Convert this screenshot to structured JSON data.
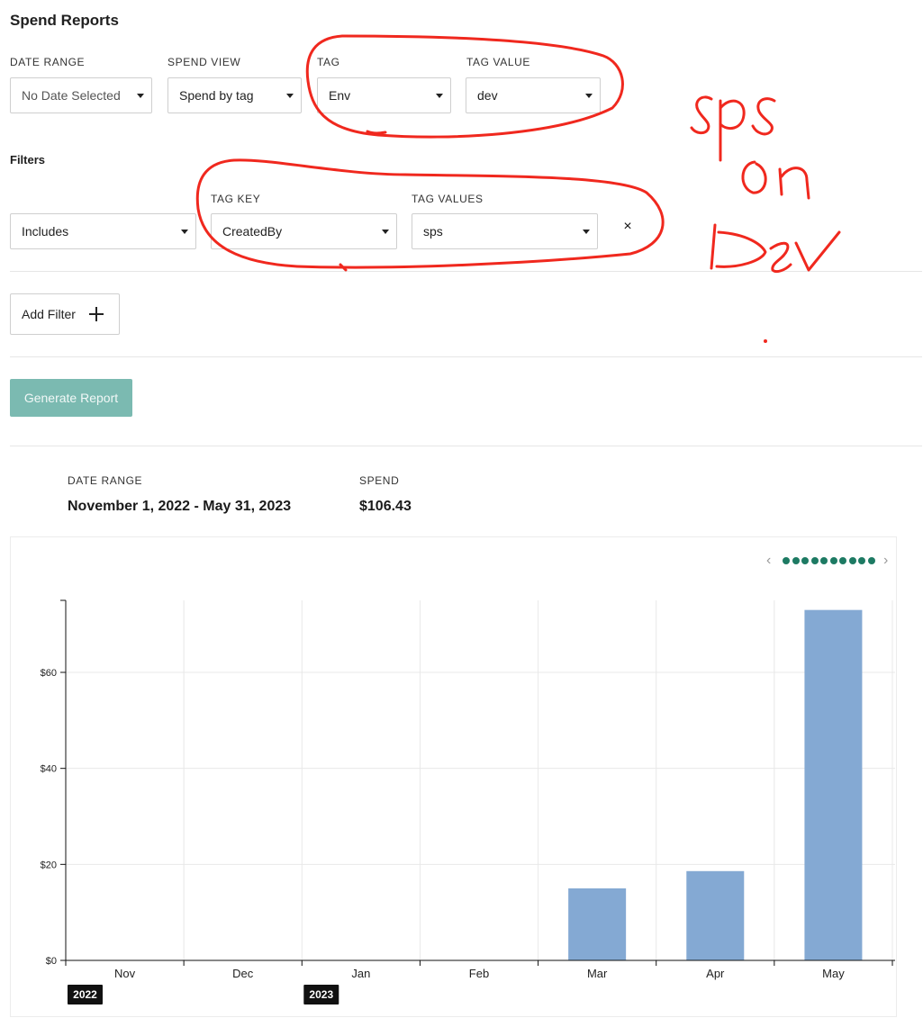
{
  "page": {
    "title": "Spend Reports"
  },
  "controls": {
    "date_range": {
      "label": "DATE RANGE",
      "value": "No Date Selected"
    },
    "spend_view": {
      "label": "SPEND VIEW",
      "value": "Spend by tag"
    },
    "tag": {
      "label": "TAG",
      "value": "Env"
    },
    "tag_value": {
      "label": "TAG VALUE",
      "value": "dev"
    }
  },
  "filters": {
    "title": "Filters",
    "operator": "Includes",
    "tag_key": {
      "label": "TAG KEY",
      "value": "CreatedBy"
    },
    "tag_values": {
      "label": "TAG VALUES",
      "value": "sps"
    },
    "remove_glyph": "×",
    "add_label": "Add Filter"
  },
  "actions": {
    "generate_label": "Generate Report"
  },
  "summary": {
    "date_range_label": "DATE RANGE",
    "date_range_value": "November 1, 2022 - May 31, 2023",
    "spend_label": "SPEND",
    "spend_value": "$106.43"
  },
  "pager": {
    "dots": 10,
    "active_index": 9
  },
  "colors": {
    "accent": "#1d7a63",
    "button_disabled": "#7bbab1",
    "bar": "#84a9d3",
    "annotation": "#f0281e"
  },
  "annotation": {
    "text": "sps on Dev"
  },
  "chart_data": {
    "type": "bar",
    "categories": [
      "Nov",
      "Dec",
      "Jan",
      "Feb",
      "Mar",
      "Apr",
      "May"
    ],
    "year_labels": [
      {
        "category": "Nov",
        "text": "2022"
      },
      {
        "category": "Jan",
        "text": "2023"
      }
    ],
    "values": [
      0,
      0,
      0,
      0,
      15,
      18.6,
      73
    ],
    "y_ticks": [
      "$0",
      "$20",
      "$40",
      "$60"
    ],
    "y_tick_values": [
      0,
      20,
      40,
      60
    ],
    "ylim": [
      0,
      75
    ],
    "grid": true,
    "title": "",
    "xlabel": "",
    "ylabel": ""
  }
}
